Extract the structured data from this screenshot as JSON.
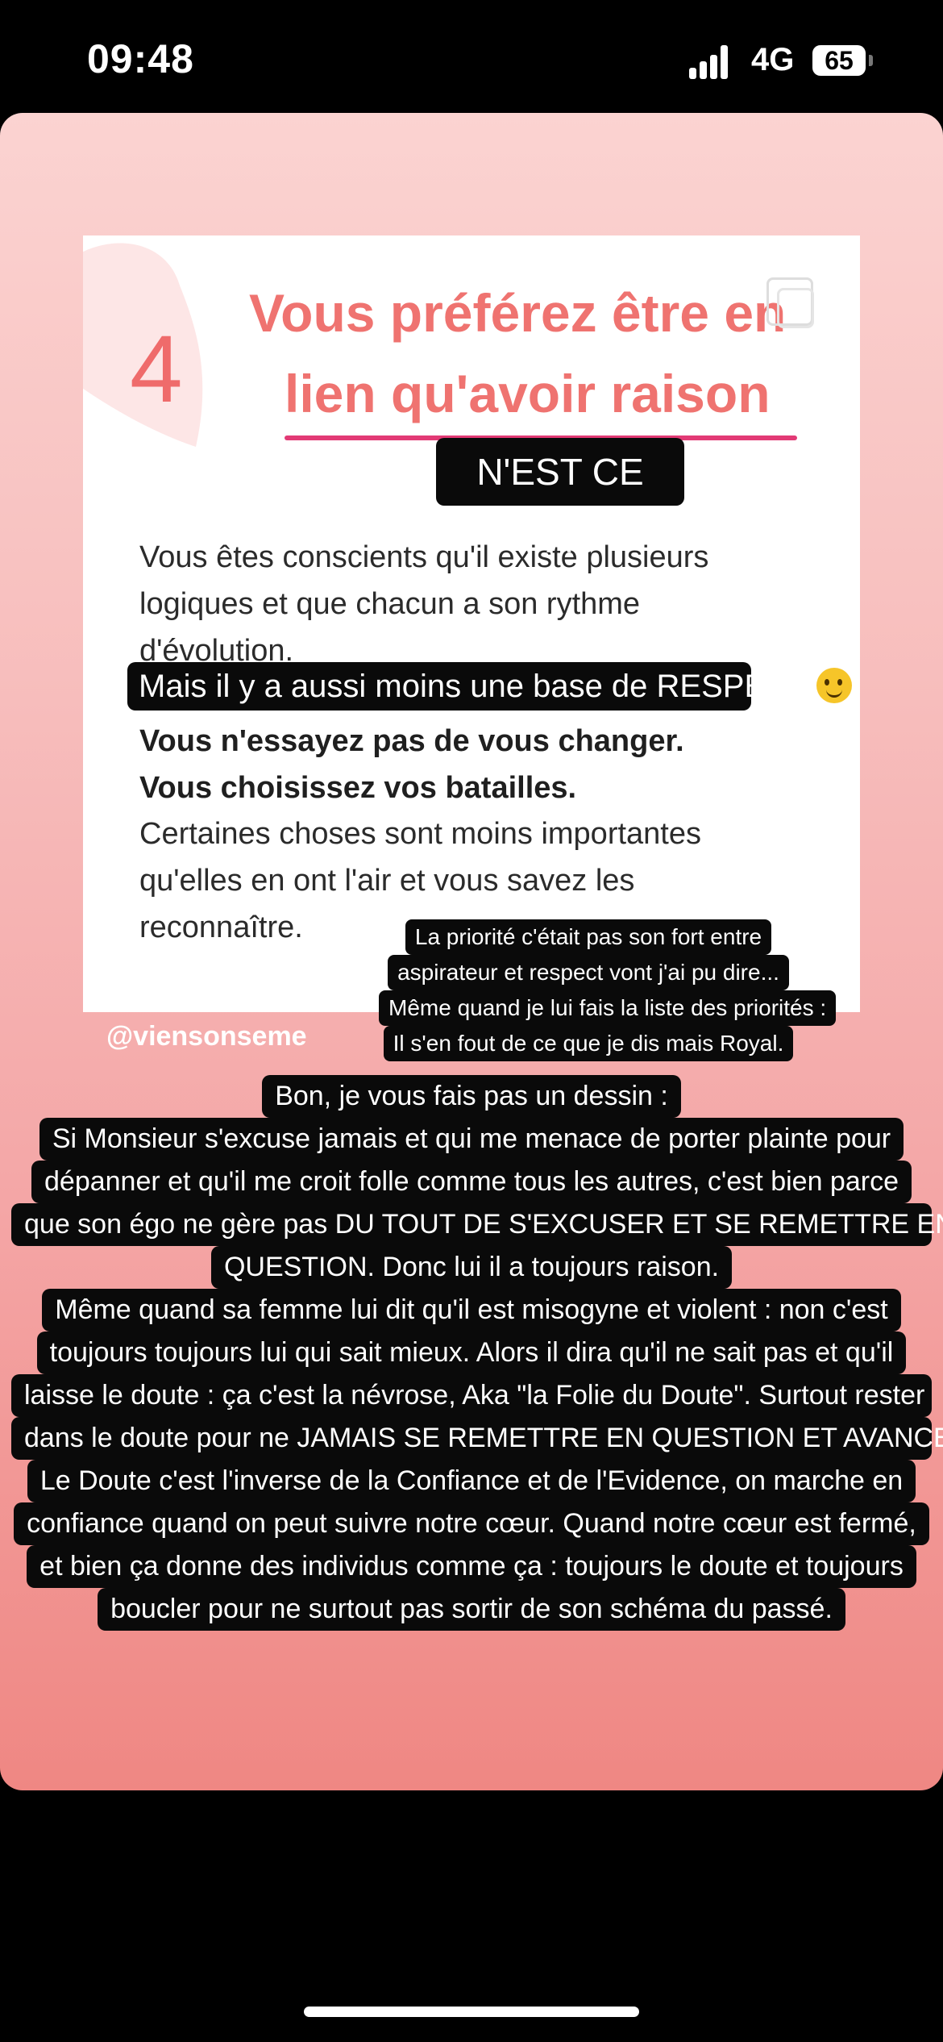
{
  "status_bar": {
    "time": "09:48",
    "network": "4G",
    "battery": "65"
  },
  "card": {
    "number": "4",
    "title_line1": "Vous préférez être en",
    "title_line2": "lien qu'avoir raison",
    "sticker": "N'EST CE PAS",
    "paragraph1": [
      "Vous êtes conscients qu'il existe plusieurs",
      "logiques et que chacun a son rythme",
      "d'évolution."
    ],
    "respect_sticker": "Mais il y a aussi moins une base de RESPECT",
    "bold_lines": [
      "Vous n'essayez pas de vous changer.",
      "Vous choisissez vos batailles."
    ],
    "paragraph2": [
      "Certaines choses sont moins importantes",
      "qu'elles en ont l'air et vous savez les",
      "reconnaître."
    ]
  },
  "small_note": [
    "La priorité c'était pas son fort entre",
    "aspirateur et respect vont j'ai pu dire...",
    "Même quand je lui fais la liste des priorités :",
    "Il s'en fout de ce que je dis mais Royal."
  ],
  "handle": "@viensonseme",
  "big_note": [
    "Bon, je vous fais pas un dessin :",
    "Si Monsieur s'excuse jamais et qui me menace de porter plainte pour",
    "dépanner et qu'il me croit folle comme tous les autres, c'est bien parce",
    "que son égo ne gère pas DU TOUT DE S'EXCUSER ET SE REMETTRE EN",
    "QUESTION. Donc lui il a toujours raison.",
    "Même quand sa femme lui dit qu'il est misogyne et violent : non c'est",
    "toujours toujours lui qui sait mieux. Alors il dira qu'il ne sait pas et qu'il",
    "laisse le doute : ça c'est la névrose, Aka \"la Folie du Doute\". Surtout rester",
    "dans le doute pour ne JAMAIS SE REMETTRE EN QUESTION ET AVANCER.",
    "Le Doute c'est l'inverse de la Confiance et de l'Evidence, on marche en",
    "confiance quand on peut suivre notre cœur. Quand notre cœur est fermé,",
    "et bien ça donne des individus comme ça : toujours le doute et toujours",
    "boucler pour ne surtout pas sortir de son schéma du passé."
  ]
}
